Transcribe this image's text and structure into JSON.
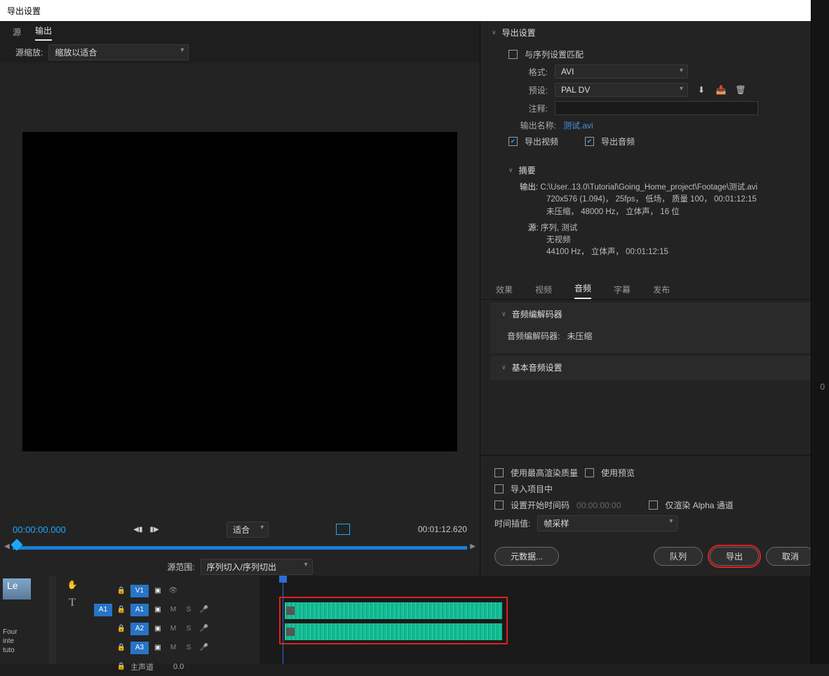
{
  "titlebar": {
    "title": "导出设置",
    "close": "✕"
  },
  "leftTabs": {
    "source": "源",
    "output": "输出"
  },
  "sourceScale": {
    "label": "源缩放:",
    "value": "缩放以适合"
  },
  "timebar": {
    "startTC": "00:00:00.000",
    "fit": "适合",
    "endTC": "00:01:12.620"
  },
  "srcRange": {
    "label": "源范围:",
    "value": "序列切入/序列切出"
  },
  "export": {
    "hdr": "导出设置",
    "matchSeq": "与序列设置匹配",
    "formatLabel": "格式:",
    "formatValue": "AVI",
    "presetLabel": "预设:",
    "presetValue": "PAL DV",
    "commentLabel": "注释:",
    "outputNameLabel": "输出名称:",
    "outputNameValue": "测试.avi",
    "exportVideo": "导出视频",
    "exportAudio": "导出音频"
  },
  "summary": {
    "hdr": "摘要",
    "outLabel": "输出:",
    "outPath": "C:\\User..13.0\\Tutorial\\Going_Home_project\\Footage\\测试.avi",
    "outLine2": "720x576 (1.094)， 25fps， 低场， 质量 100， 00:01:12:15",
    "outLine3": "未压缩， 48000 Hz， 立体声， 16 位",
    "srcLabel": "源:",
    "srcLine1": "序列, 测试",
    "srcLine2": "无视频",
    "srcLine3": "44100 Hz， 立体声， 00:01:12:15"
  },
  "rtabs": {
    "effects": "效果",
    "video": "视频",
    "audio": "音频",
    "subtitle": "字幕",
    "publish": "发布"
  },
  "audioCodec": {
    "hdr": "音频编解码器",
    "label": "音频编解码器:",
    "value": "未压缩"
  },
  "basicAudio": {
    "hdr": "基本音频设置"
  },
  "opts": {
    "maxQuality": "使用最高渲染质量",
    "usePreview": "使用预览",
    "importProject": "导入项目中",
    "setStartTC": "设置开始时间码",
    "startTCVal": "00:00:00:00",
    "alphaOnly": "仅渲染 Alpha 通道",
    "timeInterpLabel": "时间插值:",
    "timeInterpValue": "帧采样"
  },
  "buttons": {
    "metadata": "元数据...",
    "queue": "队列",
    "export": "导出",
    "cancel": "取消"
  },
  "timeline": {
    "thumbLabel": "Le",
    "desc1": "Four",
    "desc2": "inte",
    "desc3": "tuto",
    "v1": "V1",
    "a1": "A1",
    "a2": "A2",
    "a3": "A3",
    "master": "主声道",
    "masterVal": "0.0",
    "m": "M",
    "s": "S"
  },
  "rightEdge": {
    "zero": "0"
  }
}
